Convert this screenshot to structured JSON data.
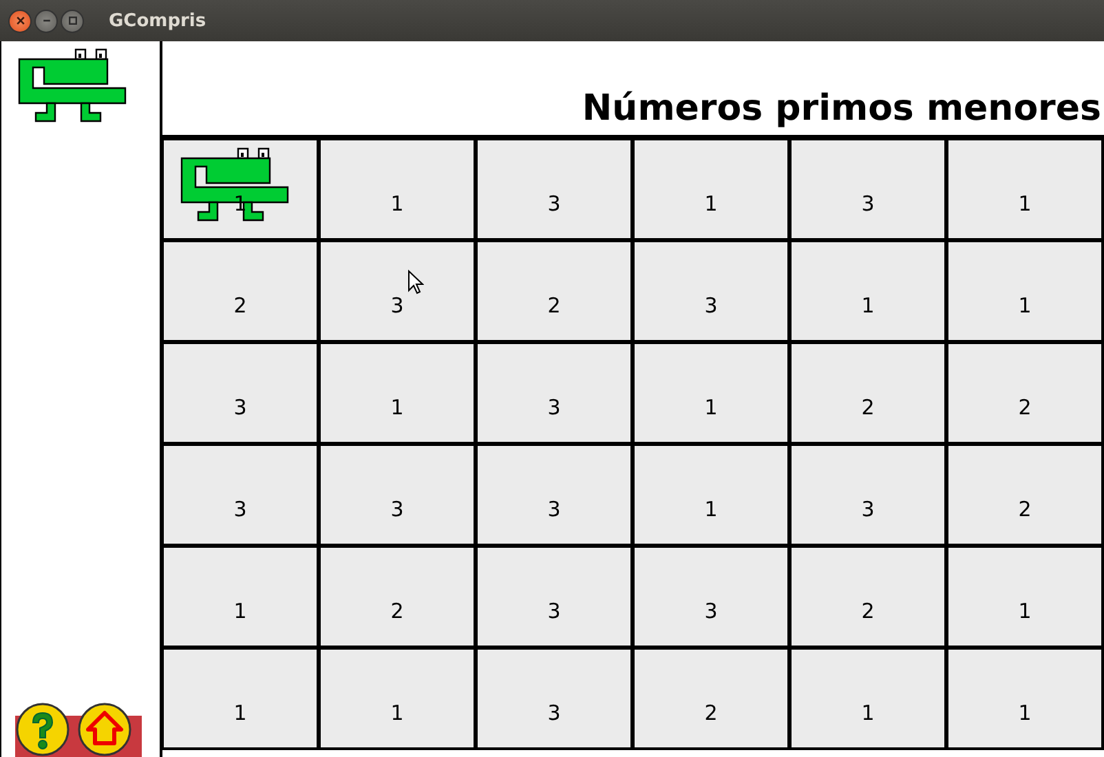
{
  "window": {
    "title": "GCompris"
  },
  "title": "Números primos menores",
  "grid": [
    [
      {
        "value": "1",
        "muncher": true
      },
      {
        "value": "1",
        "muncher": false
      },
      {
        "value": "3",
        "muncher": false
      },
      {
        "value": "1",
        "muncher": false
      },
      {
        "value": "3",
        "muncher": false
      },
      {
        "value": "1",
        "muncher": false
      }
    ],
    [
      {
        "value": "2",
        "muncher": false
      },
      {
        "value": "3",
        "muncher": false
      },
      {
        "value": "2",
        "muncher": false
      },
      {
        "value": "3",
        "muncher": false
      },
      {
        "value": "1",
        "muncher": false
      },
      {
        "value": "1",
        "muncher": false
      }
    ],
    [
      {
        "value": "3",
        "muncher": false
      },
      {
        "value": "1",
        "muncher": false
      },
      {
        "value": "3",
        "muncher": false
      },
      {
        "value": "1",
        "muncher": false
      },
      {
        "value": "2",
        "muncher": false
      },
      {
        "value": "2",
        "muncher": false
      }
    ],
    [
      {
        "value": "3",
        "muncher": false
      },
      {
        "value": "3",
        "muncher": false
      },
      {
        "value": "3",
        "muncher": false
      },
      {
        "value": "1",
        "muncher": false
      },
      {
        "value": "3",
        "muncher": false
      },
      {
        "value": "2",
        "muncher": false
      }
    ],
    [
      {
        "value": "1",
        "muncher": false
      },
      {
        "value": "2",
        "muncher": false
      },
      {
        "value": "3",
        "muncher": false
      },
      {
        "value": "3",
        "muncher": false
      },
      {
        "value": "2",
        "muncher": false
      },
      {
        "value": "1",
        "muncher": false
      }
    ],
    [
      {
        "value": "1",
        "muncher": false
      },
      {
        "value": "1",
        "muncher": false
      },
      {
        "value": "3",
        "muncher": false
      },
      {
        "value": "2",
        "muncher": false
      },
      {
        "value": "1",
        "muncher": false
      },
      {
        "value": "1",
        "muncher": false
      }
    ]
  ]
}
